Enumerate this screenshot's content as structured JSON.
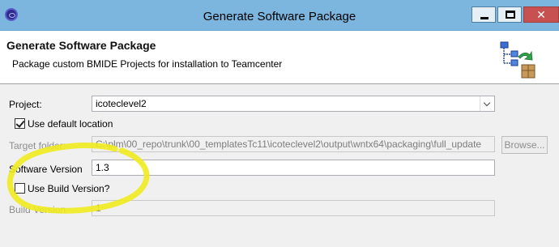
{
  "window": {
    "title": "Generate Software Package",
    "close_glyph": "✕"
  },
  "header": {
    "title": "Generate Software Package",
    "description": "Package custom BMIDE Projects for installation to Teamcenter"
  },
  "form": {
    "project_label": "Project:",
    "project_value": "icoteclevel2",
    "use_default_location_label": "Use default location",
    "use_default_location_checked": true,
    "target_folder_label": "Target folder:",
    "target_folder_value": "C:\\plm\\00_repo\\trunk\\00_templatesTc11\\icoteclevel2\\output\\wntx64\\packaging\\full_update",
    "browse_label": "Browse...",
    "software_version_label": "Software Version",
    "software_version_value": "1.3",
    "use_build_version_label": "Use Build Version?",
    "use_build_version_checked": false,
    "build_version_label": "Build Version",
    "build_version_value": "1"
  },
  "colors": {
    "titlebar": "#7cb5de",
    "close_button": "#c75050",
    "annotation": "#f0ea1e"
  }
}
